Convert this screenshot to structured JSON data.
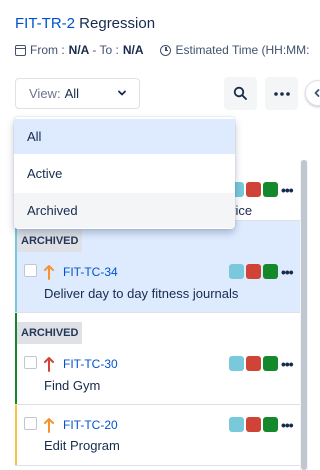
{
  "header": {
    "key": "FIT-TR-2",
    "name": "Regression",
    "from_label": "From :",
    "from_value": "N/A",
    "to_label": "- To :",
    "to_value": "N/A",
    "estimated_label": "Estimated Time (HH:MM:"
  },
  "toolbar": {
    "view_label": "View:",
    "view_value": "All",
    "icons": [
      "calendar-icon",
      "clock-icon",
      "chevron-down-icon",
      "search-icon",
      "more-icon",
      "chevron-left-icon"
    ]
  },
  "dropdown": {
    "options": [
      "All",
      "Active",
      "Archived"
    ],
    "selected": "All",
    "hovered": "Archived"
  },
  "cards": [
    {
      "summary_partial": "vice",
      "colors": [
        "#79c8dc",
        "#d04437",
        "#14892c"
      ]
    },
    {
      "tag": "ARCHIVED",
      "key": "FIT-TC-34",
      "summary": "Deliver day to day fitness journals",
      "priority": "medium",
      "priority_color": "#f79232",
      "bar_color": "#79c8dc",
      "colors": [
        "#79c8dc",
        "#d04437",
        "#14892c"
      ]
    },
    {
      "tag": "ARCHIVED",
      "key": "FIT-TC-30",
      "summary": "Find Gym",
      "priority": "high",
      "priority_color": "#d04437",
      "bar_color": "#14892c",
      "colors": [
        "#79c8dc",
        "#d04437",
        "#14892c"
      ]
    },
    {
      "key": "FIT-TC-20",
      "summary": "Edit Program",
      "priority": "medium",
      "priority_color": "#f79232",
      "bar_color": "#f6c342",
      "colors": [
        "#79c8dc",
        "#d04437",
        "#14892c"
      ]
    }
  ],
  "more_glyph": "•••"
}
